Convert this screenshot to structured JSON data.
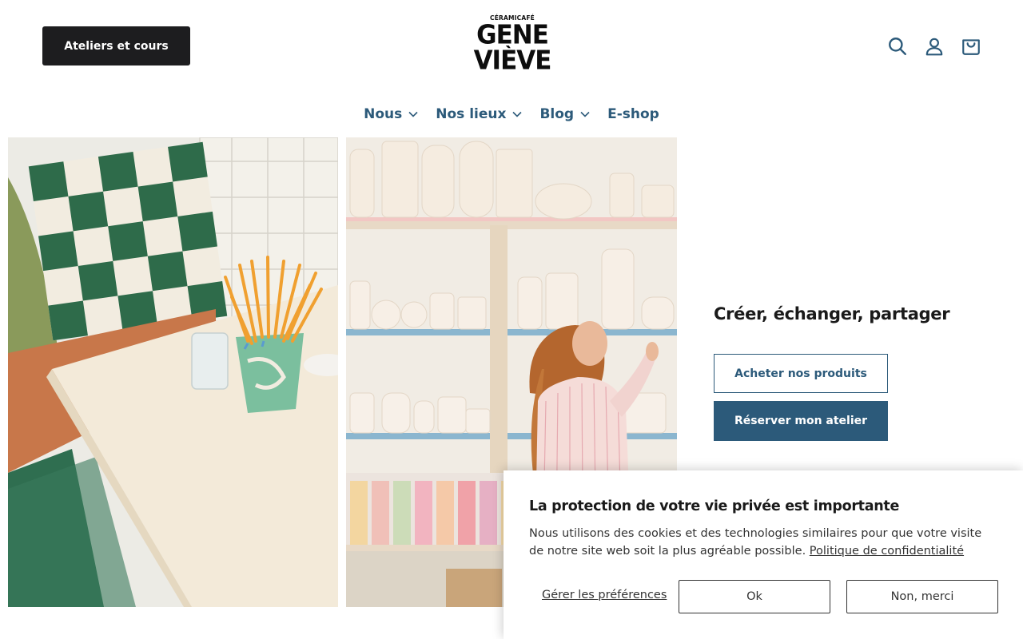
{
  "header": {
    "ateliers_button": "Ateliers et cours",
    "logo_small": "CÉRAMICAFÉ",
    "logo_line1": "GENE",
    "logo_line2": "VIÈVE",
    "icons": [
      "search-icon",
      "account-icon",
      "cart-icon"
    ]
  },
  "nav": {
    "items": [
      {
        "label": "Nous",
        "dropdown": true
      },
      {
        "label": "Nos lieux",
        "dropdown": true
      },
      {
        "label": "Blog",
        "dropdown": true
      },
      {
        "label": "E-shop",
        "dropdown": false
      }
    ]
  },
  "hero": {
    "title": "Créer, échanger, partager",
    "buy_button": "Acheter nos produits",
    "book_button": "Réserver mon atelier"
  },
  "cookie": {
    "title": "La protection de votre vie privée est importante",
    "text": "Nous utilisons des cookies et des technologies similaires pour que votre visite de notre site web soit la plus agréable possible.",
    "link": "Politique de confidentialité",
    "manage": "Gérer les préférences",
    "ok": "Ok",
    "no": "Non, merci"
  },
  "colors": {
    "accent": "#2c5a7a",
    "dark": "#1d1d1f"
  }
}
